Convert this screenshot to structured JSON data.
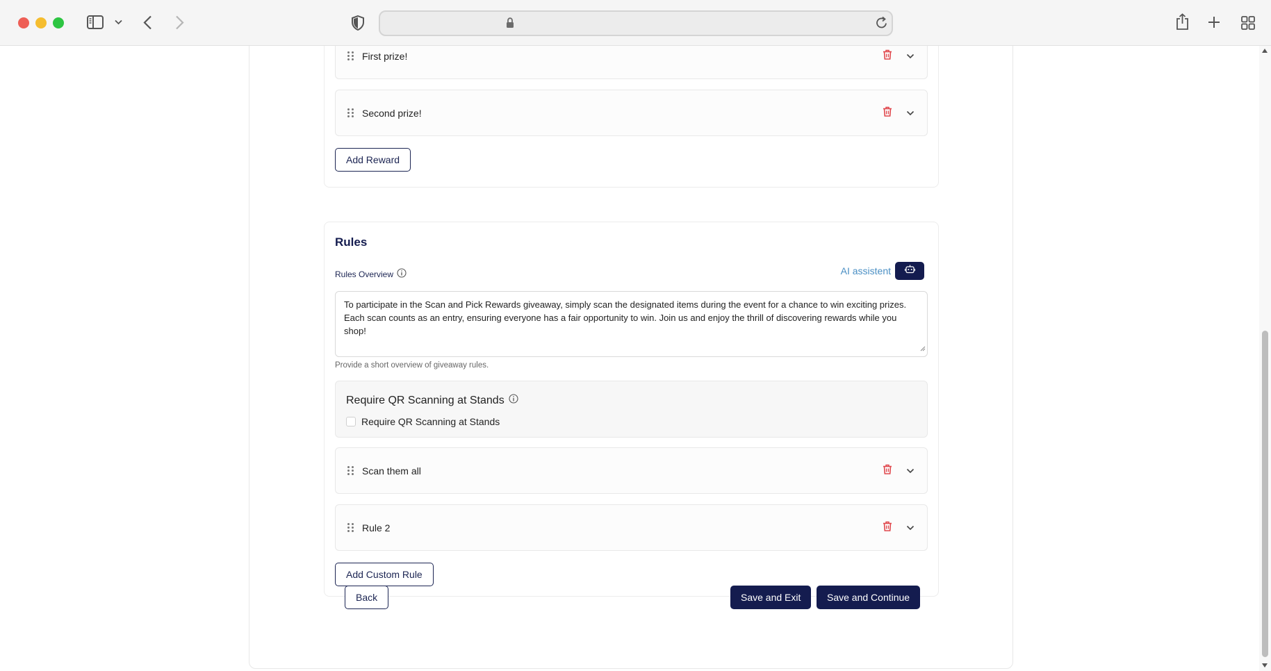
{
  "browser": {
    "icons": {
      "sidebar": "sidebar-icon",
      "back": "chevron-left-icon",
      "forward": "chevron-right-icon",
      "shield": "shield-icon",
      "lock": "lock-icon",
      "reload": "reload-icon",
      "share": "share-icon",
      "new_tab": "plus-icon",
      "tabs": "tab-grid-icon"
    }
  },
  "rewards": {
    "items": [
      {
        "label": "First prize!"
      },
      {
        "label": "Second prize!"
      }
    ],
    "add_label": "Add Reward"
  },
  "rules": {
    "title": "Rules",
    "overview_label": "Rules Overview",
    "ai_assistant_label": "AI assistent",
    "overview_text": "To participate in the Scan and Pick Rewards giveaway, simply scan the designated items during the event for a chance to win exciting prizes. Each scan counts as an entry, ensuring everyone has a fair opportunity to win. Join us and enjoy the thrill of discovering rewards while you shop!",
    "helper_text": "Provide a short overview of giveaway rules.",
    "qr": {
      "title": "Require QR Scanning at Stands",
      "checkbox_label": "Require QR Scanning at Stands",
      "checked": false
    },
    "items": [
      {
        "label": "Scan them all"
      },
      {
        "label": "Rule 2"
      }
    ],
    "add_label": "Add Custom Rule"
  },
  "footer": {
    "back_label": "Back",
    "save_exit_label": "Save and Exit",
    "save_continue_label": "Save and Continue"
  },
  "colors": {
    "primary": "#141c4f",
    "accent_link": "#4a8fc4",
    "danger": "#e0474c"
  }
}
